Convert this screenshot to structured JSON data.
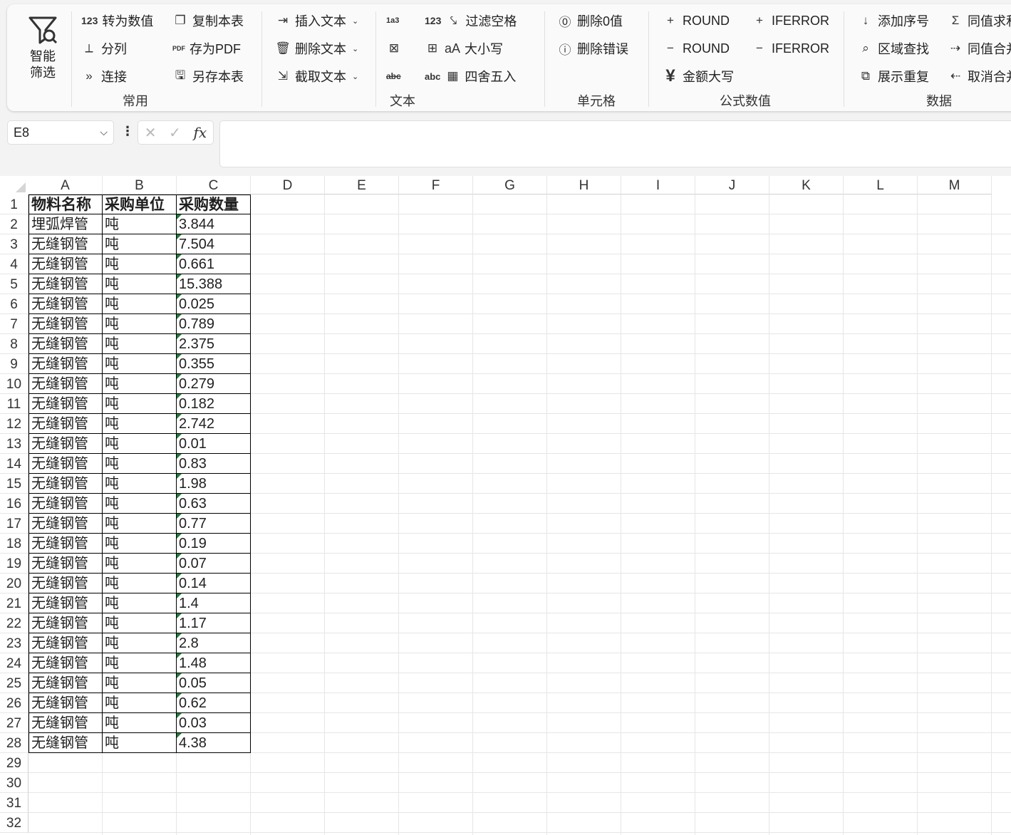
{
  "ribbon": {
    "smart_filter": {
      "label_line1": "智能",
      "label_line2": "筛选"
    },
    "groups": {
      "common": {
        "label": "常用",
        "items": [
          {
            "icon_text": "123",
            "label": "转为数值"
          },
          {
            "icon_text": "⟂",
            "label": "分列"
          },
          {
            "icon_text": "»",
            "label": "连接"
          },
          {
            "icon_text": "❐",
            "label": "复制本表"
          },
          {
            "icon_text": "PDF",
            "label": "存为PDF"
          },
          {
            "icon_text": "🖫",
            "label": "另存本表"
          }
        ]
      },
      "text": {
        "label": "文本",
        "items": [
          {
            "icon_text": "⇥",
            "label": "插入文本"
          },
          {
            "icon_text": "🗑",
            "label": "删除文本"
          },
          {
            "icon_text": "⇲",
            "label": "截取文本"
          },
          {
            "icon_text": "123",
            "label": "过滤空格"
          },
          {
            "icon_text": "aA",
            "label": "大小写"
          },
          {
            "icon_text": "▦",
            "label": "四舍五入"
          }
        ],
        "side_icons": [
          "1a3",
          "⊠",
          "abc",
          "123",
          "⊞",
          "abc"
        ]
      },
      "cell": {
        "label": "单元格",
        "items": [
          {
            "icon_text": "⓪",
            "label": "删除0值"
          },
          {
            "icon_text": "ⓘ",
            "label": "删除错误"
          }
        ]
      },
      "formula": {
        "label": "公式数值",
        "items": [
          {
            "icon_text": "+",
            "label": "ROUND"
          },
          {
            "icon_text": "−",
            "label": "ROUND"
          },
          {
            "icon_text": "¥",
            "label": "金额大写"
          },
          {
            "icon_text": "+",
            "label": "IFERROR"
          },
          {
            "icon_text": "−",
            "label": "IFERROR"
          }
        ]
      },
      "data": {
        "label": "数据",
        "items": [
          {
            "icon_text": "↓",
            "label": "添加序号"
          },
          {
            "icon_text": "⌕",
            "label": "区域查找"
          },
          {
            "icon_text": "⧉",
            "label": "展示重复"
          },
          {
            "icon_text": "Σ",
            "label": "同值求和"
          },
          {
            "icon_text": "⇢",
            "label": "同值合并"
          },
          {
            "icon_text": "⇠",
            "label": "取消合并"
          }
        ]
      }
    }
  },
  "formula_bar": {
    "name_box": "E8",
    "formula": "",
    "fx_label": "fx"
  },
  "sheet": {
    "columns": [
      "A",
      "B",
      "C",
      "D",
      "E",
      "F",
      "G",
      "H",
      "I",
      "J",
      "K",
      "L",
      "M"
    ],
    "row_numbers": [
      "1",
      "2",
      "3",
      "4",
      "5",
      "6",
      "7",
      "8",
      "9",
      "10",
      "11",
      "12",
      "13",
      "14",
      "15",
      "16",
      "17",
      "18",
      "19",
      "20",
      "21",
      "22",
      "23",
      "24",
      "25",
      "26",
      "27",
      "28",
      "29",
      "30",
      "31",
      "32"
    ],
    "headers": [
      "物料名称",
      "采购单位",
      "采购数量"
    ],
    "rows": [
      [
        "埋弧焊管",
        "吨",
        "3.844"
      ],
      [
        "无缝钢管",
        "吨",
        "7.504"
      ],
      [
        "无缝钢管",
        "吨",
        "0.661"
      ],
      [
        "无缝钢管",
        "吨",
        "15.388"
      ],
      [
        "无缝钢管",
        "吨",
        "0.025"
      ],
      [
        "无缝钢管",
        "吨",
        "0.789"
      ],
      [
        "无缝钢管",
        "吨",
        "2.375"
      ],
      [
        "无缝钢管",
        "吨",
        "0.355"
      ],
      [
        "无缝钢管",
        "吨",
        "0.279"
      ],
      [
        "无缝钢管",
        "吨",
        "0.182"
      ],
      [
        "无缝钢管",
        "吨",
        "2.742"
      ],
      [
        "无缝钢管",
        "吨",
        "0.01"
      ],
      [
        "无缝钢管",
        "吨",
        "0.83"
      ],
      [
        "无缝钢管",
        "吨",
        "1.98"
      ],
      [
        "无缝钢管",
        "吨",
        "0.63"
      ],
      [
        "无缝钢管",
        "吨",
        "0.77"
      ],
      [
        "无缝钢管",
        "吨",
        "0.19"
      ],
      [
        "无缝钢管",
        "吨",
        "0.07"
      ],
      [
        "无缝钢管",
        "吨",
        "0.14"
      ],
      [
        "无缝钢管",
        "吨",
        "1.4"
      ],
      [
        "无缝钢管",
        "吨",
        "1.17"
      ],
      [
        "无缝钢管",
        "吨",
        "2.8"
      ],
      [
        "无缝钢管",
        "吨",
        "1.48"
      ],
      [
        "无缝钢管",
        "吨",
        "0.05"
      ],
      [
        "无缝钢管",
        "吨",
        "0.62"
      ],
      [
        "无缝钢管",
        "吨",
        "0.03"
      ],
      [
        "无缝钢管",
        "吨",
        "4.38"
      ]
    ],
    "text_number_flag_color": "#1f7a38"
  }
}
